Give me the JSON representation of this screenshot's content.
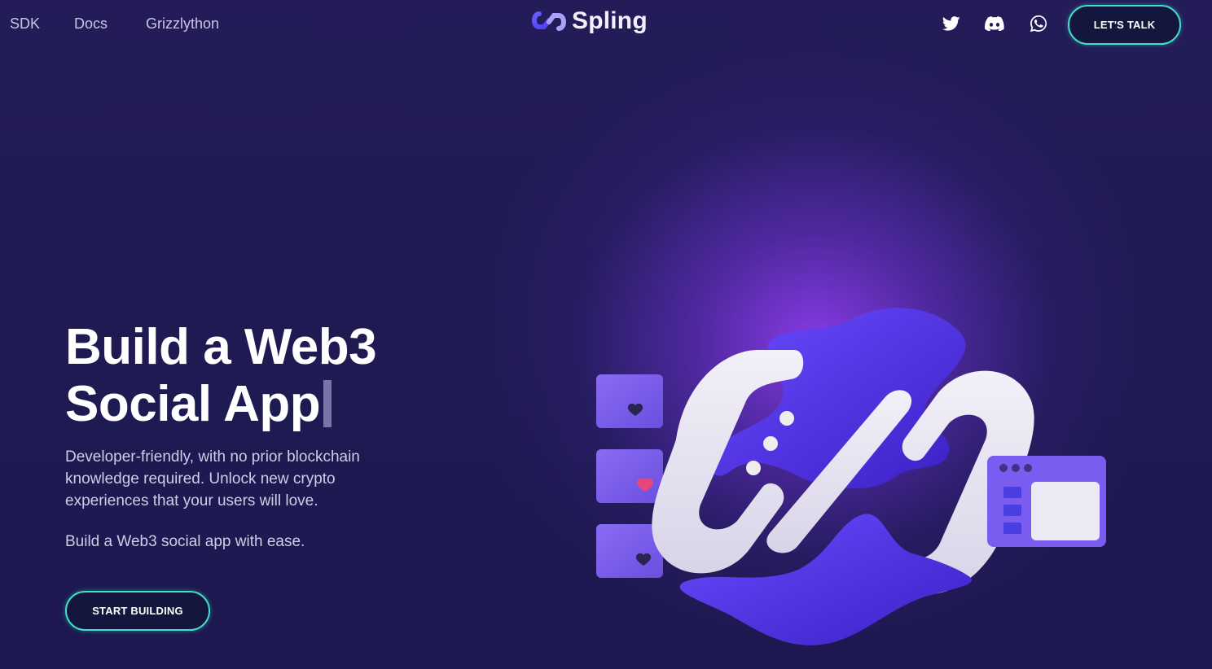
{
  "nav": {
    "links": [
      "SDK",
      "Docs",
      "Grizzlython"
    ],
    "logo_text": "Spling",
    "social_icons": [
      "twitter-icon",
      "discord-icon",
      "whatsapp-icon"
    ],
    "cta_label": "LET'S TALK"
  },
  "hero": {
    "headline_line1": "Build a Web3",
    "headline_line2": "Social App",
    "description": "Developer-friendly, with no prior blockchain knowledge required. Unlock new crypto experiences that your users will love.",
    "tagline": "Build a Web3 social app with ease.",
    "cta_label": "START BUILDING"
  },
  "colors": {
    "background": "#1e1b52",
    "accent": "#3ee0c9",
    "glow": "#8c3ceb",
    "heart": "#e8457a"
  }
}
